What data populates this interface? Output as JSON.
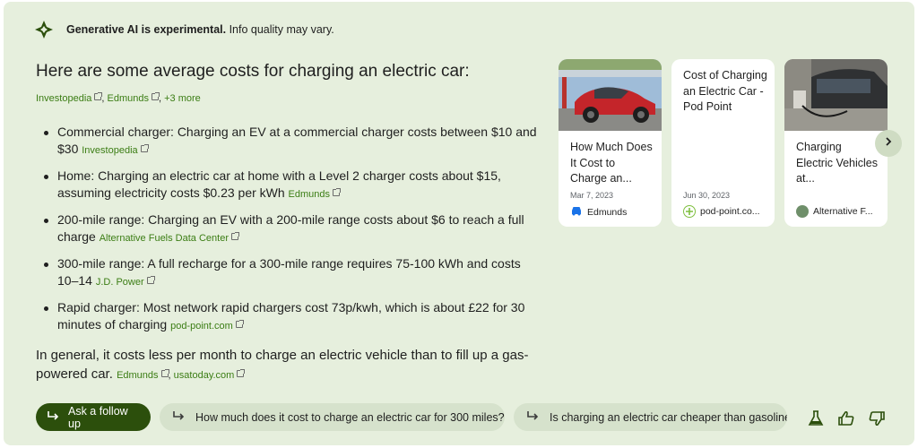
{
  "notice": {
    "bold": "Generative AI is experimental.",
    "rest": " Info quality may vary.",
    "icon": "sparkle-icon"
  },
  "heading": {
    "line": "Here are some average costs for charging an electric car:",
    "sources": [
      "Investopedia",
      "Edmunds"
    ],
    "more": "+3 more"
  },
  "bullets": [
    {
      "text": "Commercial charger: Charging an EV at a commercial charger costs between $10 and $30",
      "source": "Investopedia"
    },
    {
      "text": "Home: Charging an electric car at home with a Level 2 charger costs about $15, assuming electricity costs $0.23 per kWh",
      "source": "Edmunds"
    },
    {
      "text": "200-mile range: Charging an EV with a 200-mile range costs about $6 to reach a full charge",
      "source": "Alternative Fuels Data Center"
    },
    {
      "text": "300-mile range: A full recharge for a 300-mile range requires 75-100 kWh and costs 10–14",
      "source": "J.D. Power"
    },
    {
      "text": "Rapid charger: Most network rapid chargers cost 73p/kwh, which is about £22 for 30 minutes of charging",
      "source": "pod-point.com"
    }
  ],
  "summary": {
    "text": "In general, it costs less per month to charge an electric vehicle than to fill up a gas-powered car.",
    "sources": [
      "Edmunds",
      "usatoday.com"
    ]
  },
  "cards": [
    {
      "title": "How Much Does It Cost to Charge an...",
      "date": "Mar 7, 2023",
      "source": "Edmunds",
      "has_image": true
    },
    {
      "title": "Cost of Charging an Electric Car - Pod Point",
      "date": "Jun 30, 2023",
      "source": "pod-point.co...",
      "has_image": false
    },
    {
      "title": "Charging Electric Vehicles at...",
      "date": "",
      "source": "Alternative F...",
      "has_image": true
    }
  ],
  "followups": {
    "ask": "Ask a follow up",
    "chip1": "How much does it cost to charge an electric car for 300 miles?",
    "chip2": "Is charging an electric car cheaper than gasoline?"
  },
  "colors": {
    "panel": "#e6efdd",
    "link": "#3b7d14",
    "primary_button": "#2c4f0c",
    "chip": "#d6e2cc"
  }
}
